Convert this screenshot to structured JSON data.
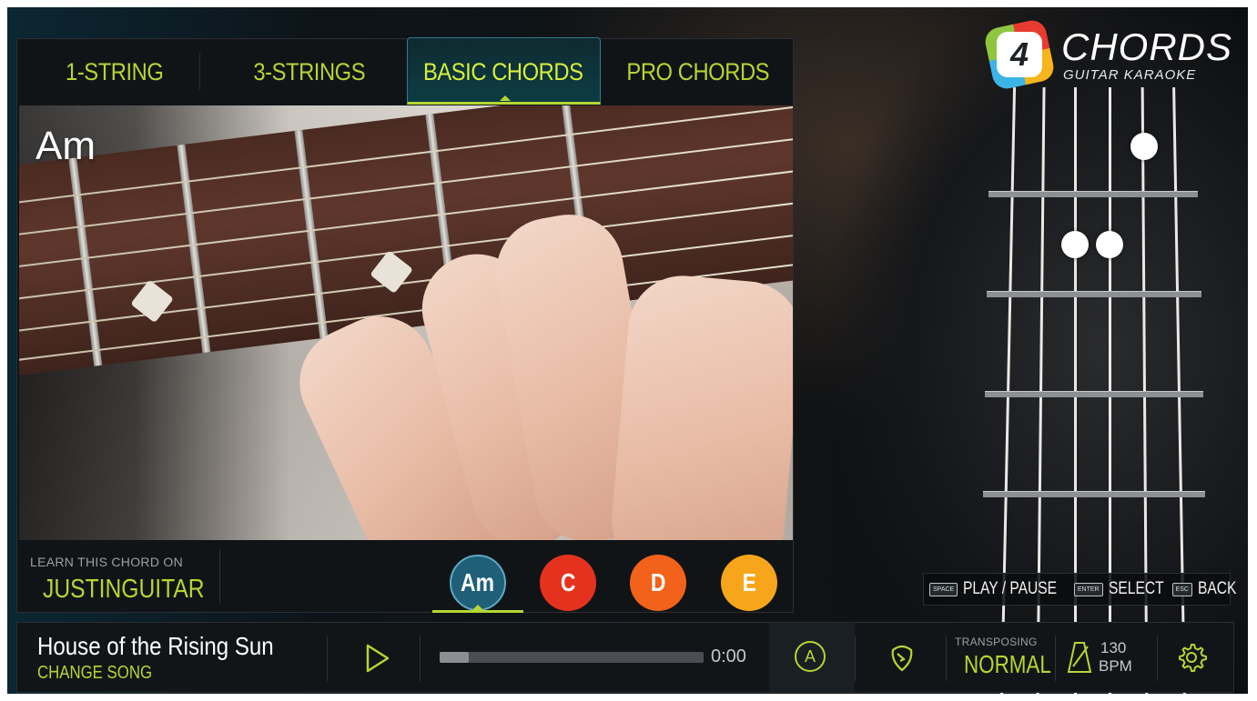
{
  "tabs": [
    {
      "label": "1-STRING",
      "active": false
    },
    {
      "label": "3-STRINGS",
      "active": false
    },
    {
      "label": "BASIC CHORDS",
      "active": true
    },
    {
      "label": "PRO CHORDS",
      "active": false
    }
  ],
  "video": {
    "chord_label": "Am"
  },
  "learn": {
    "prefix": "LEARN THIS CHORD ON",
    "site": "JUSTINGUITAR"
  },
  "chords": [
    {
      "label": "Am",
      "color": "#1f5f78",
      "selected": true
    },
    {
      "label": "C",
      "color": "#e5321f"
    },
    {
      "label": "D",
      "color": "#f2621a"
    },
    {
      "label": "E",
      "color": "#f7a51a"
    }
  ],
  "logo": {
    "number": "4",
    "title": "CHORDS",
    "subtitle": "GUITAR KARAOKE"
  },
  "hints": [
    {
      "key": "SPACE",
      "label": "PLAY / PAUSE"
    },
    {
      "key": "ENTER",
      "label": "SELECT"
    },
    {
      "key": "ESC",
      "label": "BACK"
    }
  ],
  "player": {
    "song_title": "House of the Rising Sun",
    "change_song": "CHANGE SONG",
    "time": "0:00",
    "progress": 0.11,
    "mode_button": "A",
    "transposing_label": "TRANSPOSING",
    "transposing_value": "NORMAL",
    "bpm_value": "130",
    "bpm_unit": "BPM"
  },
  "colors": {
    "accent": "#b6d534",
    "panel": "#121518"
  }
}
